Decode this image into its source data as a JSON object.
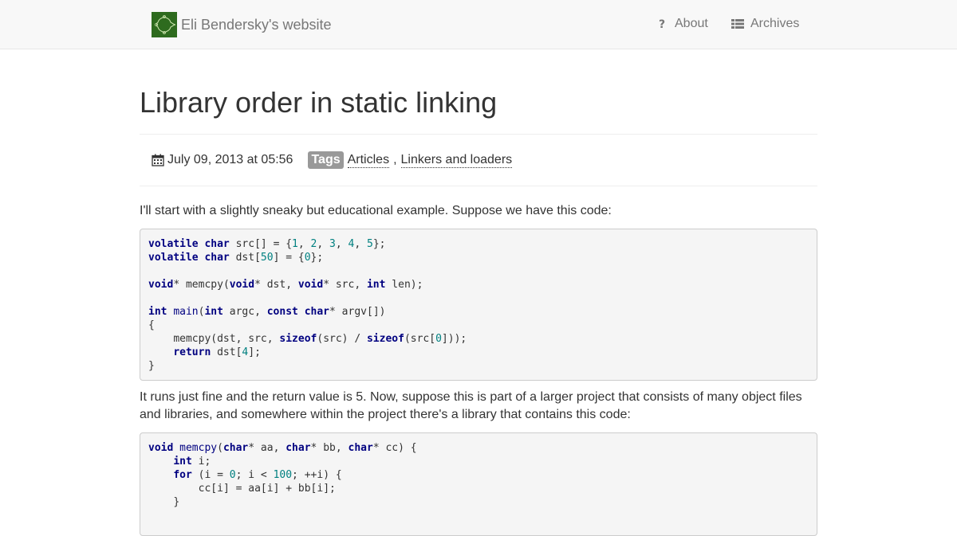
{
  "site": {
    "brand": "Eli Bendersky's website",
    "nav": [
      {
        "label": "About",
        "icon": "question-icon"
      },
      {
        "label": "Archives",
        "icon": "list-icon"
      }
    ]
  },
  "article": {
    "title": "Library order in static linking",
    "date": "July 09, 2013 at 05:56",
    "tags_label": "Tags",
    "tags": [
      "Articles",
      "Linkers and loaders"
    ],
    "tag_separator": ",",
    "paragraphs": [
      "I'll start with a slightly sneaky but educational example. Suppose we have this code:",
      "It runs just fine and the return value is 5. Now, suppose this is part of a larger project that consists of many object files and libraries, and somewhere within the project there's a library that contains this code:"
    ],
    "code_blocks": [
      [
        "volatile char src[] = {1, 2, 3, 4, 5};",
        "volatile char dst[50] = {0};",
        "",
        "void* memcpy(void* dst, void* src, int len);",
        "",
        "int main(int argc, const char* argv[])",
        "{",
        "    memcpy(dst, src, sizeof(src) / sizeof(src[0]));",
        "    return dst[4];",
        "}"
      ],
      [
        "void memcpy(char* aa, char* bb, char* cc) {",
        "    int i;",
        "    for (i = 0; i < 100; ++i) {",
        "        cc[i] = aa[i] + bb[i];",
        "    }"
      ]
    ]
  },
  "colors": {
    "keyword": "#000080",
    "number": "#008080",
    "tag_bg": "#999999",
    "logo": "#2e6b1e"
  }
}
